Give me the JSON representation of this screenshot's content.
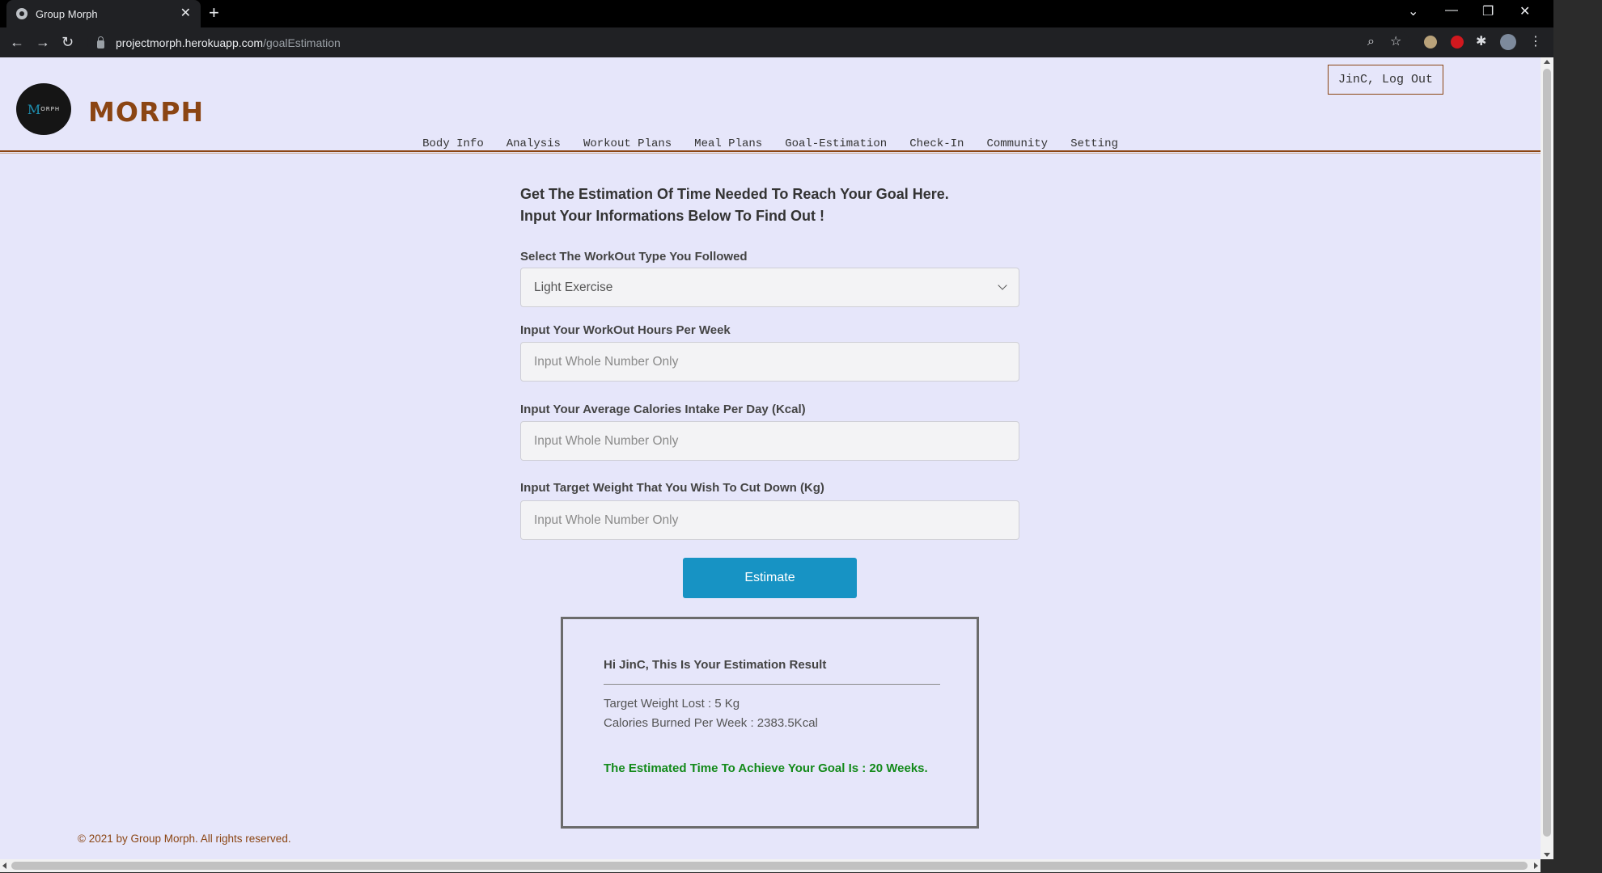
{
  "browser": {
    "tab_title": "Group Morph",
    "tab_close": "✕",
    "new_tab": "+",
    "url_host": "projectmorph.herokuapp.com",
    "url_path": "/goalEstimation",
    "win_dropdown": "⌄",
    "win_min": "—",
    "win_restore": "❐",
    "win_close": "✕",
    "back": "←",
    "forward": "→",
    "reload": "↻",
    "zoom_icon": "⌕",
    "star_icon": "☆",
    "puzzle_icon": "✱",
    "menu_icon": "⋮"
  },
  "header": {
    "logo_m": "M",
    "logo_rest": "ORPH",
    "brand": "MORPH",
    "logout_label": "JinC, Log Out",
    "accent_color": "#8b4513"
  },
  "nav": {
    "items": [
      "Body Info",
      "Analysis",
      "Workout Plans",
      "Meal Plans",
      "Goal-Estimation",
      "Check-In",
      "Community",
      "Setting"
    ]
  },
  "form": {
    "heading_line1": "Get The Estimation Of Time Needed To Reach Your Goal Here.",
    "heading_line2": "Input Your Informations Below To Find Out !",
    "workout_type_label": "Select The WorkOut Type You Followed",
    "workout_type_value": "Light Exercise",
    "hours_label": "Input Your WorkOut Hours Per Week",
    "hours_placeholder": "Input Whole Number Only",
    "calories_label": "Input Your Average Calories Intake Per Day (Kcal)",
    "calories_placeholder": "Input Whole Number Only",
    "target_label": "Input Target Weight That You Wish To Cut Down (Kg)",
    "target_placeholder": "Input Whole Number Only",
    "estimate_label": "Estimate",
    "button_color": "#1793c4"
  },
  "result": {
    "title": "Hi JinC, This Is Your Estimation Result",
    "target_weight_lost": "Target Weight Lost : 5 Kg",
    "calories_burned": "Calories Burned Per Week : 2383.5Kcal",
    "estimated_time": "The Estimated Time To Achieve Your Goal Is : 20 Weeks.",
    "highlight_color": "#138a1a"
  },
  "footer": {
    "copyright": "© 2021 by Group Morph. All rights reserved."
  }
}
